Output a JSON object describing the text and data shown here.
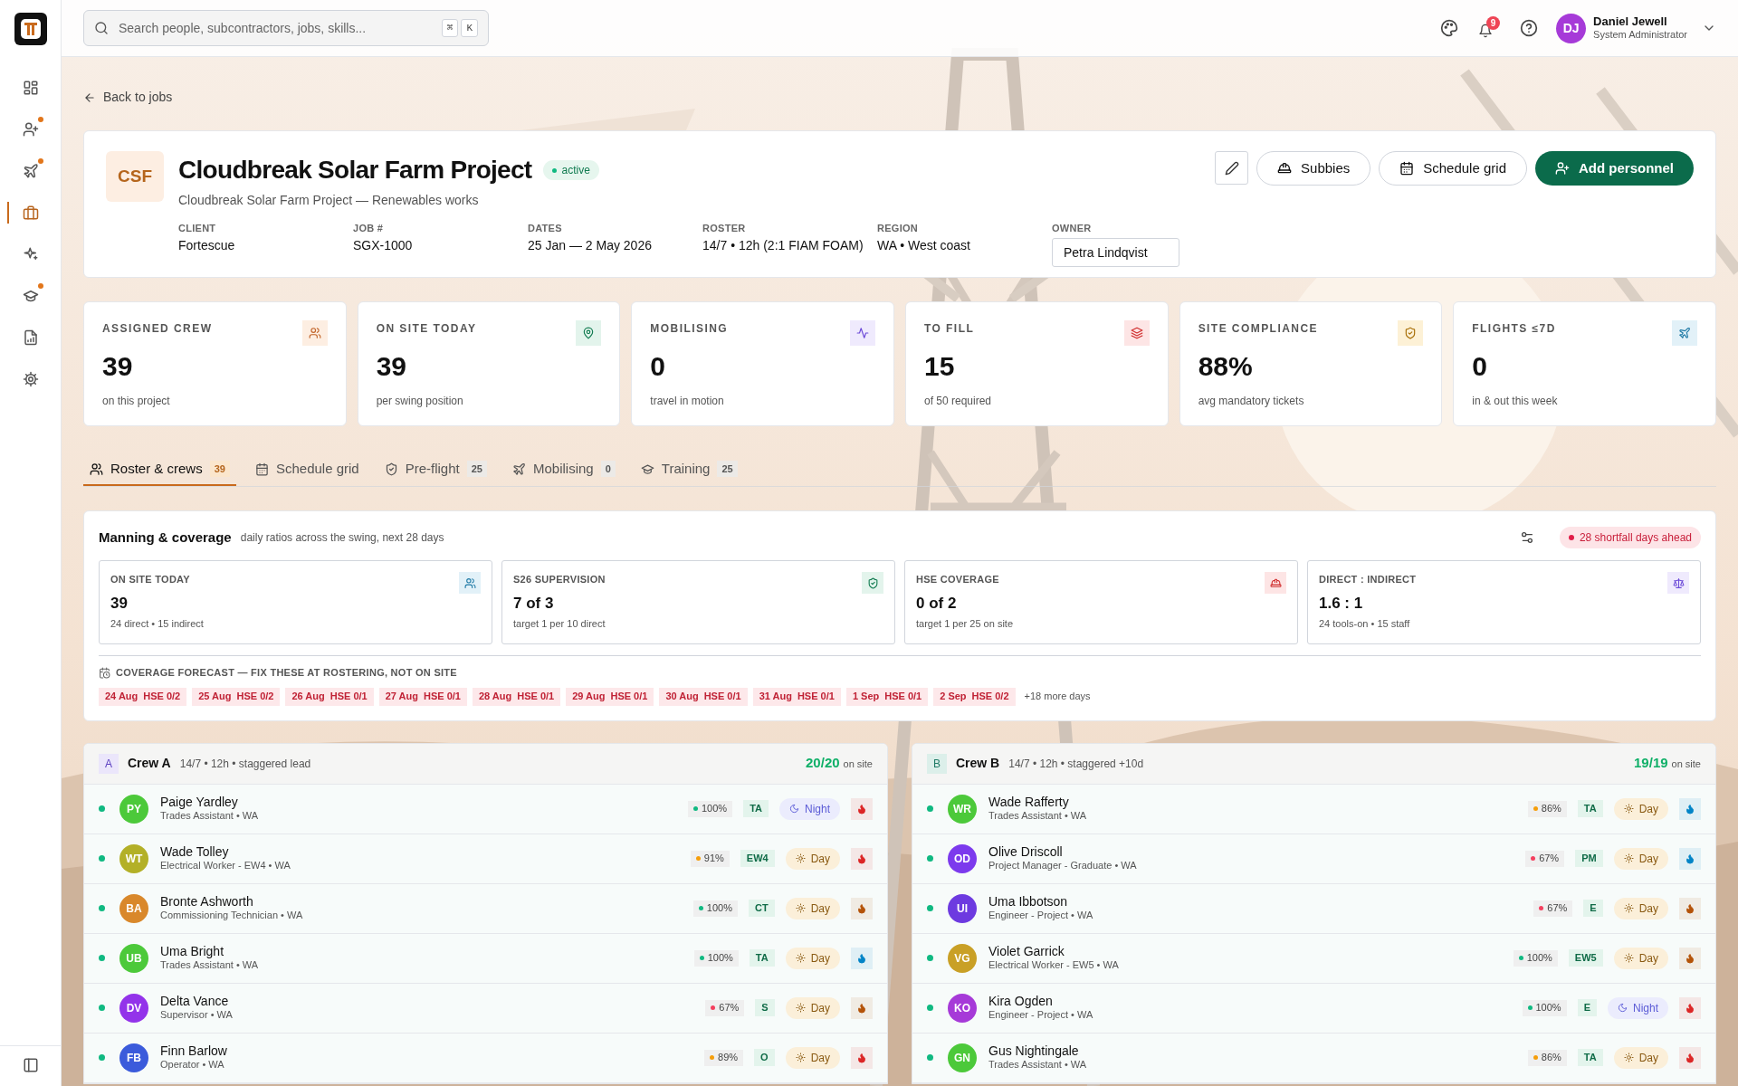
{
  "sidebar": {
    "items": [
      {
        "selected": false,
        "badge": false
      },
      {
        "selected": false,
        "badge": true
      },
      {
        "selected": false,
        "badge": true
      },
      {
        "selected": true,
        "badge": false
      },
      {
        "selected": false,
        "badge": false
      },
      {
        "selected": false,
        "badge": true
      },
      {
        "selected": false,
        "badge": false
      },
      {
        "selected": false,
        "badge": false
      }
    ]
  },
  "header": {
    "search": {
      "placeholder": "Search people, subcontractors, jobs, skills...",
      "keys": [
        "⌘",
        "K"
      ]
    },
    "notifications": "9",
    "user": {
      "initials": "DJ",
      "name": "Daniel Jewell",
      "role": "System Administrator"
    }
  },
  "back_link": "Back to jobs",
  "job": {
    "logo": "CSF",
    "title": "Cloudbreak Solar Farm Project",
    "status": "active",
    "subtitle": "Cloudbreak Solar Farm Project — Renewables works",
    "meta": [
      {
        "label": "CLIENT",
        "value": "Fortescue"
      },
      {
        "label": "JOB #",
        "value": "SGX-1000"
      },
      {
        "label": "DATES",
        "value": "25 Jan — 2 May 2026"
      },
      {
        "label": "ROSTER",
        "value": "14/7 • 12h (2:1 FIAM FOAM)"
      },
      {
        "label": "REGION",
        "value": "WA • West coast"
      }
    ],
    "owner": {
      "label": "OWNER",
      "value": "Petra Lindqvist"
    },
    "actions": [
      {
        "kind": "edit"
      },
      {
        "kind": "outline",
        "label": "Subbies"
      },
      {
        "kind": "outline",
        "label": "Schedule grid"
      },
      {
        "kind": "primary",
        "label": "Add personnel"
      }
    ]
  },
  "stats": [
    {
      "label": "ASSIGNED CREW",
      "value": "39",
      "sub": "on this project"
    },
    {
      "label": "ON SITE TODAY",
      "value": "39",
      "sub": "per swing position"
    },
    {
      "label": "MOBILISING",
      "value": "0",
      "sub": "travel in motion"
    },
    {
      "label": "TO FILL",
      "value": "15",
      "sub": "of 50 required"
    },
    {
      "label": "SITE COMPLIANCE",
      "value": "88%",
      "sub": "avg mandatory tickets"
    },
    {
      "label": "FLIGHTS ≤7D",
      "value": "0",
      "sub": "in & out this week"
    }
  ],
  "tabs": [
    {
      "label": "Roster & crews",
      "count": "39",
      "selected": true
    },
    {
      "label": "Schedule grid",
      "selected": false
    },
    {
      "label": "Pre-flight",
      "count": "25",
      "selected": false
    },
    {
      "label": "Mobilising",
      "count": "0",
      "selected": false
    },
    {
      "label": "Training",
      "count": "25",
      "selected": false
    }
  ],
  "manning": {
    "title": "Manning & coverage",
    "subtitle": "daily ratios across the swing, next 28 days",
    "alert": "28 shortfall days ahead",
    "metrics": [
      {
        "label": "ON SITE TODAY",
        "value": "39",
        "sub": "24 direct • 15 indirect"
      },
      {
        "label": "S26 SUPERVISION",
        "value": "7 of 3",
        "sub": "target 1 per 10 direct"
      },
      {
        "label": "HSE COVERAGE",
        "value": "0 of 2",
        "sub": "target 1 per 25 on site"
      },
      {
        "label": "DIRECT : INDIRECT",
        "value": "1.6 : 1",
        "sub": "24 tools-on • 15 staff"
      }
    ],
    "forecast_title": "COVERAGE FORECAST — FIX THESE AT ROSTERING, NOT ON SITE",
    "forecast": [
      {
        "date": "24 Aug",
        "text": "HSE 0/2"
      },
      {
        "date": "25 Aug",
        "text": "HSE 0/2"
      },
      {
        "date": "26 Aug",
        "text": "HSE 0/1"
      },
      {
        "date": "27 Aug",
        "text": "HSE 0/1"
      },
      {
        "date": "28 Aug",
        "text": "HSE 0/1"
      },
      {
        "date": "29 Aug",
        "text": "HSE 0/1"
      },
      {
        "date": "30 Aug",
        "text": "HSE 0/1"
      },
      {
        "date": "31 Aug",
        "text": "HSE 0/1"
      },
      {
        "date": "1 Sep",
        "text": "HSE 0/1"
      },
      {
        "date": "2 Sep",
        "text": "HSE 0/2"
      }
    ],
    "more": "+18 more days"
  },
  "crews": [
    {
      "letter": "A",
      "name": "Crew A",
      "meta": "14/7 • 12h • staggered lead",
      "count": "20/20",
      "count_suffix": "on site",
      "members": [
        {
          "avatar": {
            "initials": "PY",
            "color": "#4cc93a"
          },
          "name": "Paige Yardley",
          "role": "Trades Assistant • WA",
          "on_site": true,
          "compliance": {
            "text": "100%",
            "color": "#10b981"
          },
          "trade": "TA",
          "shift": {
            "kind": "night",
            "label": "Night"
          },
          "fatigue": {
            "color": "#dc2626"
          }
        },
        {
          "avatar": {
            "initials": "WT",
            "color": "#b3b027"
          },
          "name": "Wade Tolley",
          "role": "Electrical Worker - EW4 • WA",
          "on_site": true,
          "compliance": {
            "text": "91%",
            "color": "#f59e0b"
          },
          "trade": "EW4",
          "shift": {
            "kind": "day",
            "label": "Day"
          },
          "fatigue": {
            "color": "#dc2626"
          }
        },
        {
          "avatar": {
            "initials": "BA",
            "color": "#d9882b"
          },
          "name": "Bronte Ashworth",
          "role": "Commissioning Technician • WA",
          "on_site": true,
          "compliance": {
            "text": "100%",
            "color": "#10b981"
          },
          "trade": "CT",
          "shift": {
            "kind": "day",
            "label": "Day"
          },
          "fatigue": {
            "color": "#b45309"
          }
        },
        {
          "avatar": {
            "initials": "UB",
            "color": "#4cc93a"
          },
          "name": "Uma Bright",
          "role": "Trades Assistant • WA",
          "on_site": true,
          "compliance": {
            "text": "100%",
            "color": "#10b981"
          },
          "trade": "TA",
          "shift": {
            "kind": "day",
            "label": "Day"
          },
          "fatigue": {
            "color": "#0284c7"
          }
        },
        {
          "avatar": {
            "initials": "DV",
            "color": "#9333ea"
          },
          "name": "Delta Vance",
          "role": "Supervisor • WA",
          "on_site": true,
          "compliance": {
            "text": "67%",
            "color": "#f43f5e"
          },
          "trade": "S",
          "shift": {
            "kind": "day",
            "label": "Day"
          },
          "fatigue": {
            "color": "#b45309"
          }
        },
        {
          "avatar": {
            "initials": "FB",
            "color": "#3b5bdb"
          },
          "name": "Finn Barlow",
          "role": "Operator • WA",
          "on_site": true,
          "compliance": {
            "text": "89%",
            "color": "#f59e0b"
          },
          "trade": "O",
          "shift": {
            "kind": "day",
            "label": "Day"
          },
          "fatigue": {
            "color": "#dc2626"
          }
        }
      ]
    },
    {
      "letter": "B",
      "name": "Crew B",
      "meta": "14/7 • 12h • staggered +10d",
      "count": "19/19",
      "count_suffix": "on site",
      "members": [
        {
          "avatar": {
            "initials": "WR",
            "color": "#4cc93a"
          },
          "name": "Wade Rafferty",
          "role": "Trades Assistant • WA",
          "on_site": true,
          "compliance": {
            "text": "86%",
            "color": "#f59e0b"
          },
          "trade": "TA",
          "shift": {
            "kind": "day",
            "label": "Day"
          },
          "fatigue": {
            "color": "#0284c7"
          }
        },
        {
          "avatar": {
            "initials": "OD",
            "color": "#7c3aed"
          },
          "name": "Olive Driscoll",
          "role": "Project Manager - Graduate • WA",
          "on_site": true,
          "compliance": {
            "text": "67%",
            "color": "#f43f5e"
          },
          "trade": "PM",
          "shift": {
            "kind": "day",
            "label": "Day"
          },
          "fatigue": {
            "color": "#0284c7"
          }
        },
        {
          "avatar": {
            "initials": "UI",
            "color": "#6d3ae0"
          },
          "name": "Uma Ibbotson",
          "role": "Engineer - Project • WA",
          "on_site": true,
          "compliance": {
            "text": "67%",
            "color": "#f43f5e"
          },
          "trade": "E",
          "shift": {
            "kind": "day",
            "label": "Day"
          },
          "fatigue": {
            "color": "#b45309"
          }
        },
        {
          "avatar": {
            "initials": "VG",
            "color": "#c9a026"
          },
          "name": "Violet Garrick",
          "role": "Electrical Worker - EW5 • WA",
          "on_site": true,
          "compliance": {
            "text": "100%",
            "color": "#10b981"
          },
          "trade": "EW5",
          "shift": {
            "kind": "day",
            "label": "Day"
          },
          "fatigue": {
            "color": "#b45309"
          }
        },
        {
          "avatar": {
            "initials": "KO",
            "color": "#a63ad8"
          },
          "name": "Kira Ogden",
          "role": "Engineer - Project • WA",
          "on_site": true,
          "compliance": {
            "text": "100%",
            "color": "#10b981"
          },
          "trade": "E",
          "shift": {
            "kind": "night",
            "label": "Night"
          },
          "fatigue": {
            "color": "#dc2626"
          }
        },
        {
          "avatar": {
            "initials": "GN",
            "color": "#4cc93a"
          },
          "name": "Gus Nightingale",
          "role": "Trades Assistant • WA",
          "on_site": true,
          "compliance": {
            "text": "86%",
            "color": "#f59e0b"
          },
          "trade": "TA",
          "shift": {
            "kind": "day",
            "label": "Day"
          },
          "fatigue": {
            "color": "#dc2626"
          }
        }
      ]
    }
  ]
}
